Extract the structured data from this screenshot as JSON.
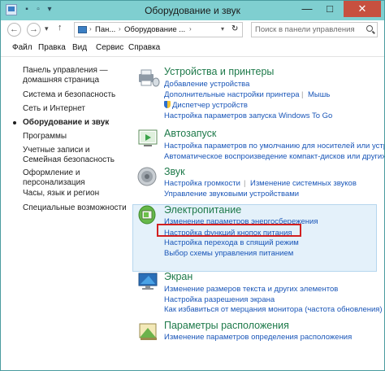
{
  "window": {
    "title": "Оборудование и звук",
    "minimize_glyph": "—",
    "maximize_glyph": "□",
    "close_glyph": "✕"
  },
  "address": {
    "crumbs": [
      "Пан...",
      "Оборудование ..."
    ],
    "search_placeholder": "Поиск в панели управления"
  },
  "menu": [
    "Файл",
    "Правка",
    "Вид",
    "Сервис",
    "Справка"
  ],
  "sidebar": {
    "items": [
      {
        "label": "Панель управления — домашняя страница",
        "active": false
      },
      {
        "label": "Система и безопасность",
        "active": false
      },
      {
        "label": "Сеть и Интернет",
        "active": false
      },
      {
        "label": "Оборудование и звук",
        "active": true
      },
      {
        "label": "Программы",
        "active": false
      },
      {
        "label": "Учетные записи и Семейная безопасность",
        "active": false
      },
      {
        "label": "Оформление и персонализация",
        "active": false
      },
      {
        "label": "Часы, язык и регион",
        "active": false
      },
      {
        "label": "Специальные возможности",
        "active": false
      }
    ]
  },
  "sections": {
    "devices": {
      "title": "Устройства и принтеры",
      "links": [
        "Добавление устройства",
        "Дополнительные настройки принтера",
        "Мышь",
        "Диспетчер устройств",
        "Настройка параметров запуска Windows To Go"
      ]
    },
    "autoplay": {
      "title": "Автозапуск",
      "links": [
        "Настройка параметров по умолчанию для носителей или устройств",
        "Автоматическое воспроизведение компакт-дисков или других носителей"
      ]
    },
    "sound": {
      "title": "Звук",
      "links": [
        "Настройка громкости",
        "Изменение системных звуков",
        "Управление звуковыми устройствами"
      ]
    },
    "power": {
      "title": "Электропитание",
      "links": [
        "Изменение параметров энергосбережения",
        "Настройка функций кнопок питания",
        "Настройка перехода в спящий режим",
        "Выбор схемы управления питанием"
      ]
    },
    "display": {
      "title": "Экран",
      "links": [
        "Изменение размеров текста и других элементов",
        "Настройка разрешения экрана",
        "Как избавиться от мерцания монитора (частота обновления)"
      ]
    },
    "location": {
      "title": "Параметры расположения",
      "links": [
        "Изменение параметров определения расположения"
      ]
    }
  },
  "colors": {
    "titlebar": "#7fcfd0",
    "section_title": "#1e7a4a",
    "link": "#1a56b8",
    "highlight": "#e4f1fa",
    "annotation": "#d22020"
  }
}
